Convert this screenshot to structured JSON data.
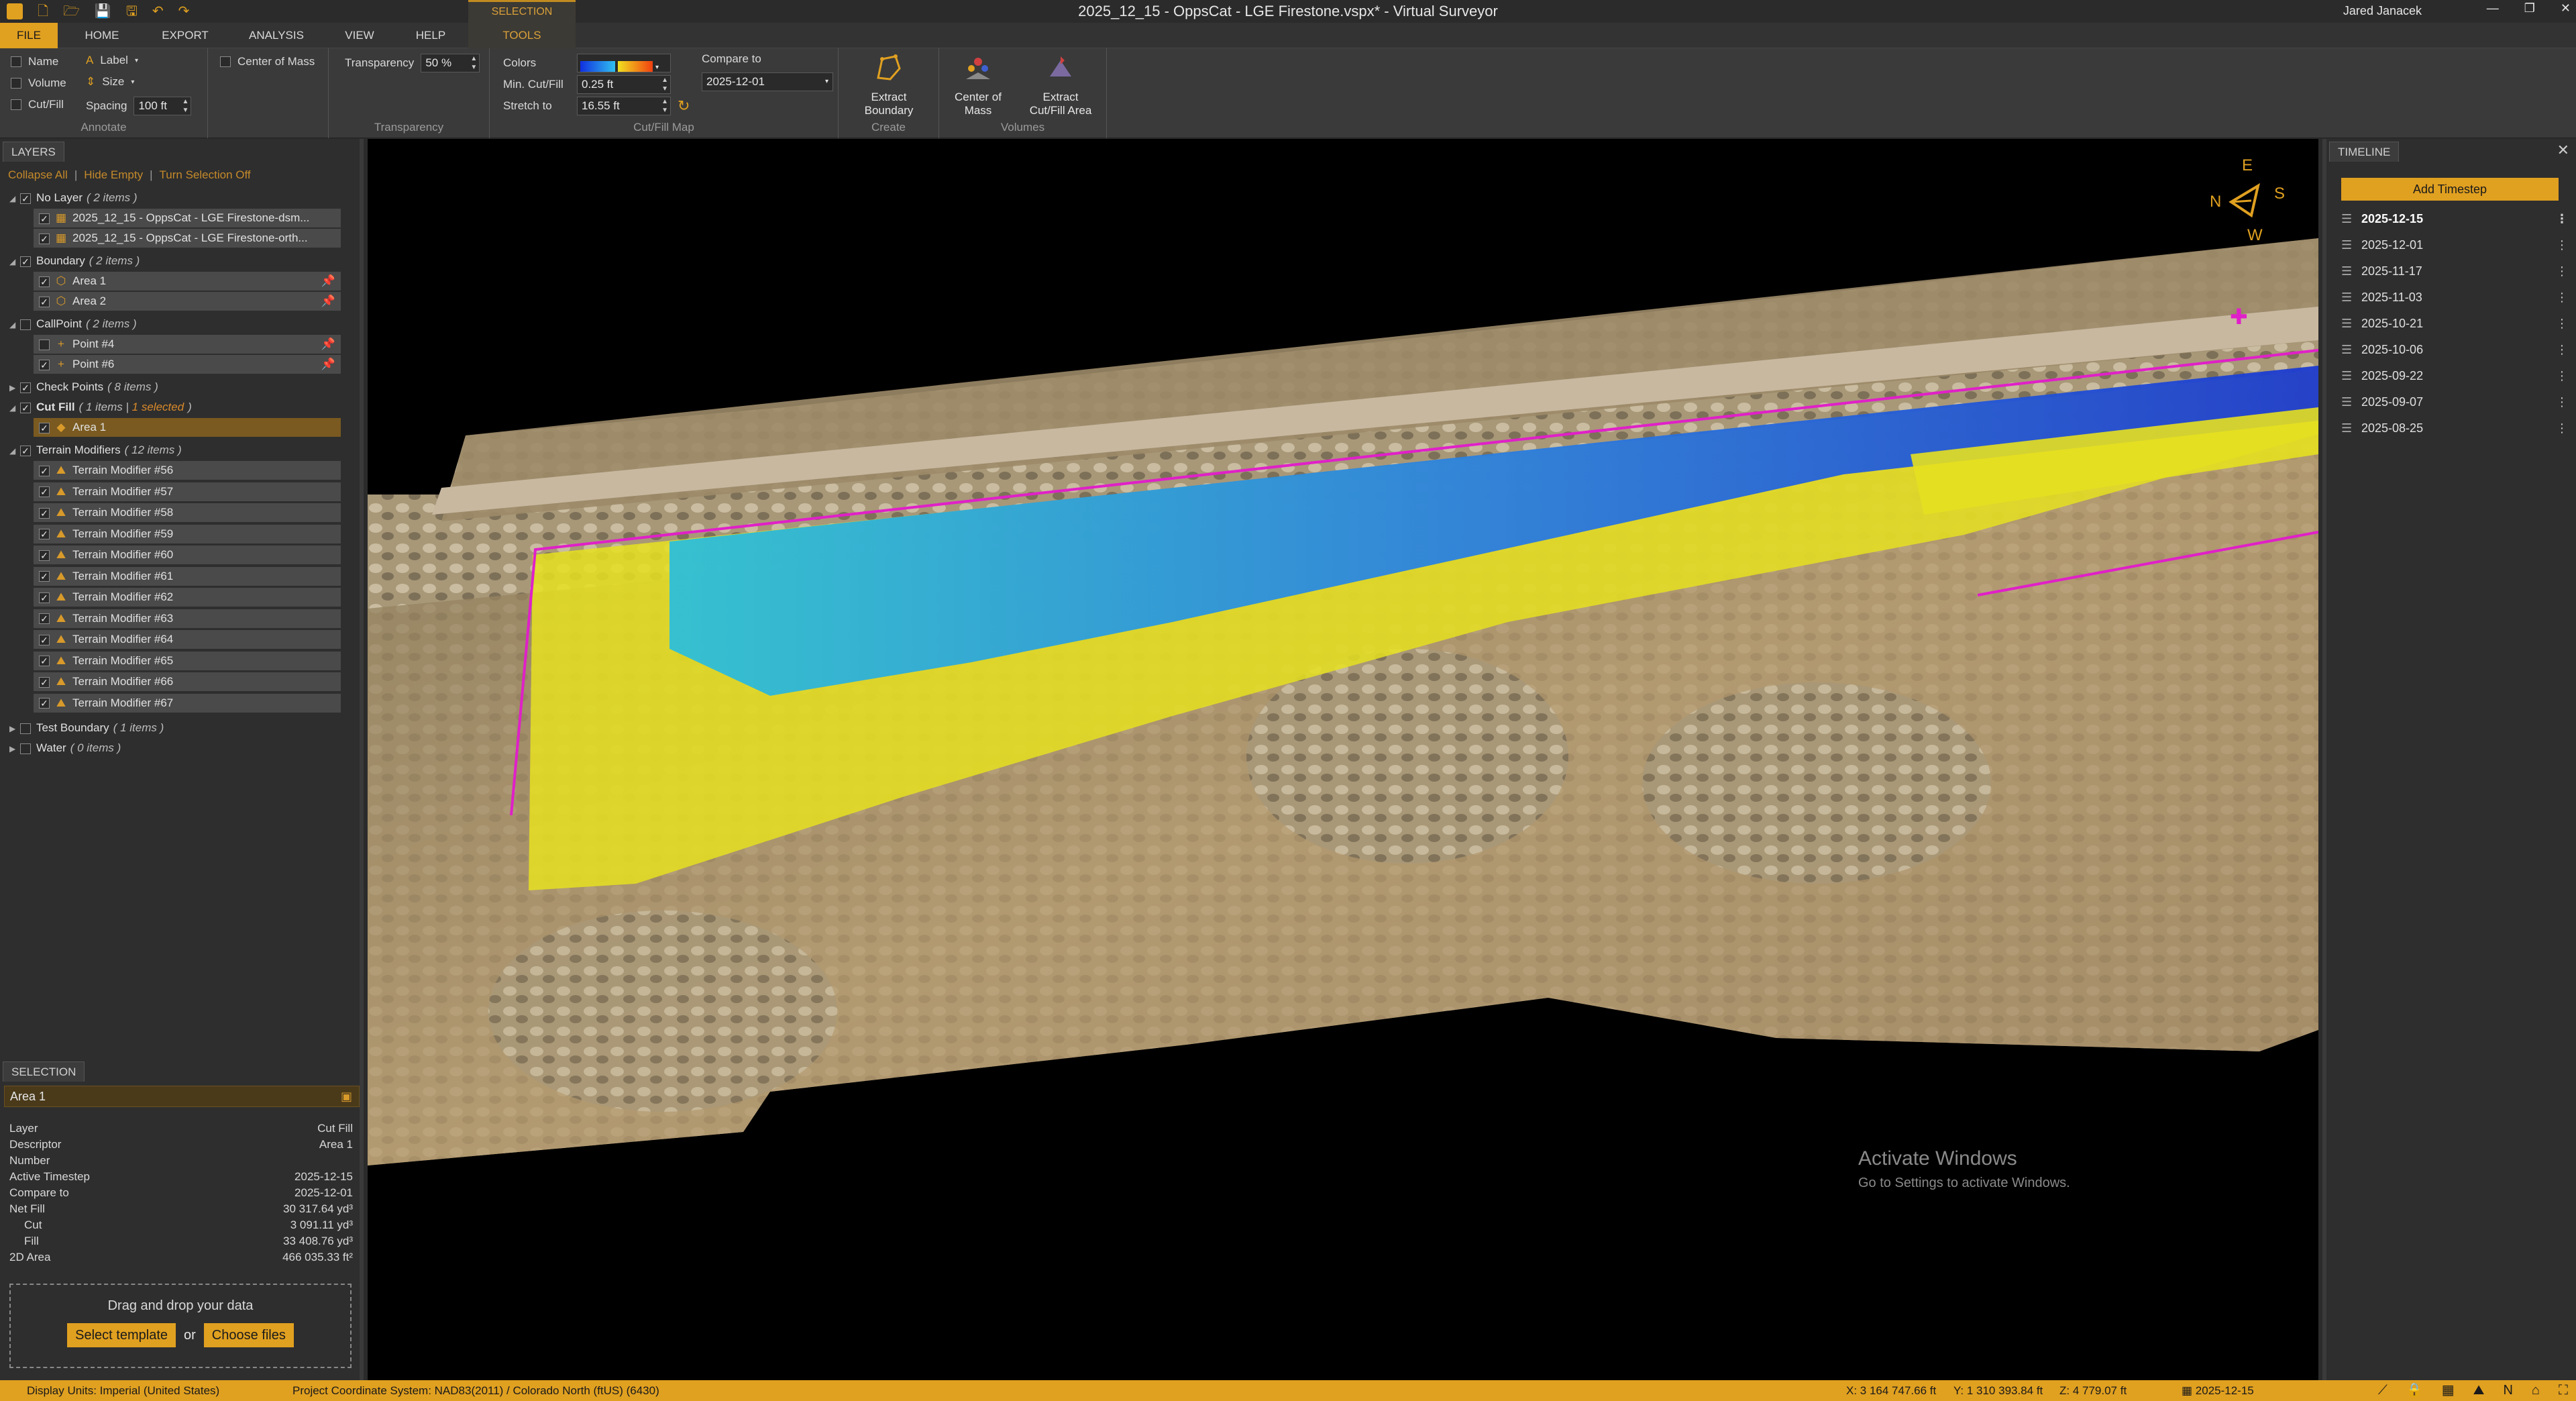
{
  "window": {
    "title": "2025_12_15 - OppsCat - LGE Firestone.vspx* - Virtual Surveyor",
    "user": "Jared Janacek",
    "context_tab": "SELECTION"
  },
  "menu": {
    "file": "FILE",
    "home": "HOME",
    "export": "EXPORT",
    "analysis": "ANALYSIS",
    "view": "VIEW",
    "help": "HELP",
    "tools": "TOOLS"
  },
  "ribbon": {
    "annotate": {
      "name": "Name",
      "label": "Label",
      "volume": "Volume",
      "size": "Size",
      "cutfill": "Cut/Fill",
      "spacing": "Spacing",
      "spacing_value": "100 ft",
      "center_of_mass": "Center of Mass",
      "group": "Annotate"
    },
    "transparency": {
      "label": "Transparency",
      "value": "50 %",
      "group": "Transparency"
    },
    "cutfill_map": {
      "colors": "Colors",
      "compare_to": "Compare to",
      "compare_value": "2025-12-01",
      "min_cutfill": "Min. Cut/Fill",
      "min_value": "0.25 ft",
      "stretch_to": "Stretch to",
      "stretch_value": "16.55 ft",
      "group": "Cut/Fill Map"
    },
    "create": {
      "extract_boundary": "Extract Boundary",
      "group": "Create"
    },
    "volumes": {
      "center_of_mass": "Center of Mass",
      "extract_cutfill": "Extract Cut/Fill Area",
      "group": "Volumes"
    }
  },
  "layers": {
    "tab": "LAYERS",
    "actions": {
      "collapse": "Collapse All",
      "hide_empty": "Hide Empty",
      "turn_off": "Turn Selection Off"
    },
    "groups": {
      "nolayer": {
        "name": "No Layer",
        "count": "( 2 items )",
        "items": [
          "2025_12_15 - OppsCat - LGE Firestone-dsm...",
          "2025_12_15 - OppsCat - LGE Firestone-orth..."
        ]
      },
      "boundary": {
        "name": "Boundary",
        "count": "( 2 items )",
        "items": [
          "Area 1",
          "Area 2"
        ]
      },
      "callpoint": {
        "name": "CallPoint",
        "count": "( 2 items )",
        "items": [
          "Point #4",
          "Point #6"
        ]
      },
      "checkpoints": {
        "name": "Check Points",
        "count": "( 8 items )"
      },
      "cutfill": {
        "name": "Cut Fill",
        "count": "( 1 items |",
        "selected": "1 selected",
        "close": ")",
        "items": [
          "Area 1"
        ]
      },
      "terrain": {
        "name": "Terrain Modifiers",
        "count": "( 12 items )",
        "items": [
          "Terrain Modifier #56",
          "Terrain Modifier #57",
          "Terrain Modifier #58",
          "Terrain Modifier #59",
          "Terrain Modifier #60",
          "Terrain Modifier #61",
          "Terrain Modifier #62",
          "Terrain Modifier #63",
          "Terrain Modifier #64",
          "Terrain Modifier #65",
          "Terrain Modifier #66",
          "Terrain Modifier #67"
        ]
      },
      "testboundary": {
        "name": "Test Boundary",
        "count": "( 1 items )"
      },
      "water": {
        "name": "Water",
        "count": "( 0 items )"
      }
    }
  },
  "selection": {
    "tab": "SELECTION",
    "title": "Area 1",
    "props": [
      {
        "k": "Layer",
        "v": "Cut Fill"
      },
      {
        "k": "Descriptor",
        "v": "Area 1"
      },
      {
        "k": "Number",
        "v": ""
      },
      {
        "k": "Active Timestep",
        "v": "2025-12-15"
      },
      {
        "k": "Compare to",
        "v": "2025-12-01"
      },
      {
        "k": "Net Fill",
        "v": "30 317.64 yd³"
      },
      {
        "k": "Cut",
        "v": "3 091.11 yd³"
      },
      {
        "k": "Fill",
        "v": "33 408.76 yd³"
      },
      {
        "k": "2D Area",
        "v": "466 035.33 ft²"
      }
    ]
  },
  "dropzone": {
    "message": "Drag and drop your data",
    "template": "Select template",
    "or": "or",
    "files": "Choose files"
  },
  "compass": {
    "n": "N",
    "e": "E",
    "s": "S",
    "w": "W"
  },
  "watermark": {
    "line1": "Activate Windows",
    "line2": "Go to Settings to activate Windows."
  },
  "timeline": {
    "tab": "TIMELINE",
    "add": "Add Timestep",
    "steps": [
      "2025-12-15",
      "2025-12-01",
      "2025-11-17",
      "2025-11-03",
      "2025-10-21",
      "2025-10-06",
      "2025-09-22",
      "2025-09-07",
      "2025-08-25"
    ]
  },
  "status": {
    "units": "Display Units:  Imperial (United States)",
    "crs": "Project Coordinate System:  NAD83(2011) / Colorado North (ftUS) (6430)",
    "x": "X: 3 164 747.66 ft",
    "y": "Y: 1 310 393.84 ft",
    "z": "Z: 4 779.07 ft",
    "date": "2025-12-15"
  },
  "colors": {
    "accent": "#e0a020",
    "boundary": "#e020c8",
    "cut": "#1e5ad8",
    "fill": "#e6e020"
  }
}
